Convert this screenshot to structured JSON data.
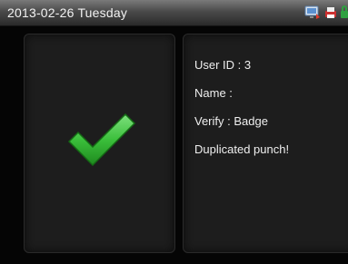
{
  "title_bar": {
    "date_text": "2013-02-26  Tuesday",
    "status_icons": [
      "network-icon",
      "printer-icon",
      "lock-icon"
    ]
  },
  "result": {
    "icon": "checkmark-icon",
    "color": "#3bbf3b"
  },
  "details": {
    "user_id": "User ID : 3",
    "name": "Name :",
    "verify": "Verify : Badge",
    "message": "Duplicated punch!"
  }
}
